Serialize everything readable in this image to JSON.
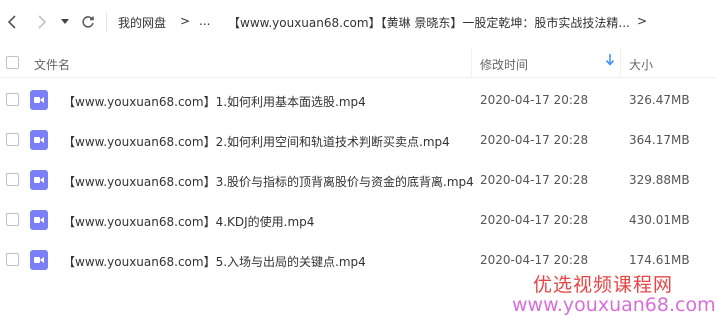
{
  "nav": {
    "back_icon": "chevron-left-icon",
    "forward_icon": "chevron-right-icon",
    "dropdown_icon": "caret-down-icon",
    "refresh_icon": "refresh-icon",
    "breadcrumb": {
      "root": "我的网盘",
      "separator": ">",
      "ellipsis": "...",
      "current": "【www.youxuan68.com】【黄琳 景晓东】一股定乾坤：股市实战技法精...",
      "trailing": ">"
    }
  },
  "table": {
    "headers": {
      "name": "文件名",
      "modified": "修改时间",
      "size": "大小"
    },
    "sort_icon": "arrow-down-icon",
    "accent_color": "#3b8cff",
    "rows": [
      {
        "name": "【www.youxuan68.com】1.如何利用基本面选股.mp4",
        "modified": "2020-04-17 20:28",
        "size": "326.47MB",
        "icon": "video-file-icon"
      },
      {
        "name": "【www.youxuan68.com】2.如何利用空间和轨道技术判断买卖点.mp4",
        "modified": "2020-04-17 20:28",
        "size": "364.17MB",
        "icon": "video-file-icon"
      },
      {
        "name": "【www.youxuan68.com】3.股价与指标的顶背离股价与资金的底背离.mp4",
        "modified": "2020-04-17 20:28",
        "size": "329.88MB",
        "icon": "video-file-icon"
      },
      {
        "name": "【www.youxuan68.com】4.KDJ的使用.mp4",
        "modified": "2020-04-17 20:28",
        "size": "430.01MB",
        "icon": "video-file-icon"
      },
      {
        "name": "【www.youxuan68.com】5.入场与出局的关键点.mp4",
        "modified": "2020-04-17 20:28",
        "size": "174.61MB",
        "icon": "video-file-icon"
      }
    ]
  },
  "watermark": {
    "line1": "优选视频课程网",
    "line2": "www.youxuan68.com"
  }
}
